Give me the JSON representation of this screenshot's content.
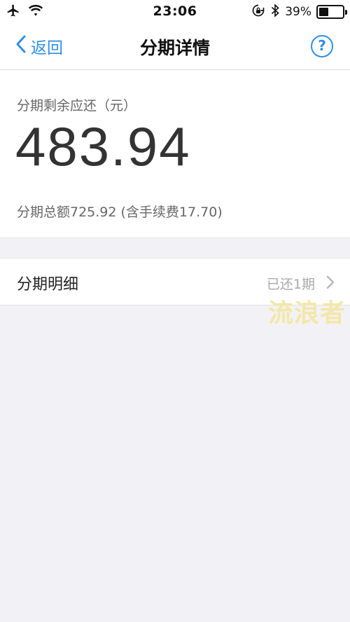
{
  "status_bar": {
    "time": "23:06",
    "battery_percent": "39%",
    "battery_level": 0.39,
    "icons": [
      "airplane-icon",
      "wifi-icon",
      "rotation-lock-icon",
      "bluetooth-icon",
      "battery-icon"
    ]
  },
  "nav": {
    "back_label": "返回",
    "title": "分期详情",
    "help_symbol": "?"
  },
  "summary": {
    "label": "分期剩余应还（元）",
    "amount": "483.94",
    "total_text": "分期总额725.92 (含手续费17.70)"
  },
  "detail": {
    "label": "分期明细",
    "value": "已还1期"
  },
  "watermark": "流浪者",
  "colors": {
    "accent": "#2f8fe5",
    "background": "#f2f2f6",
    "watermark": "#f3e7a8"
  }
}
